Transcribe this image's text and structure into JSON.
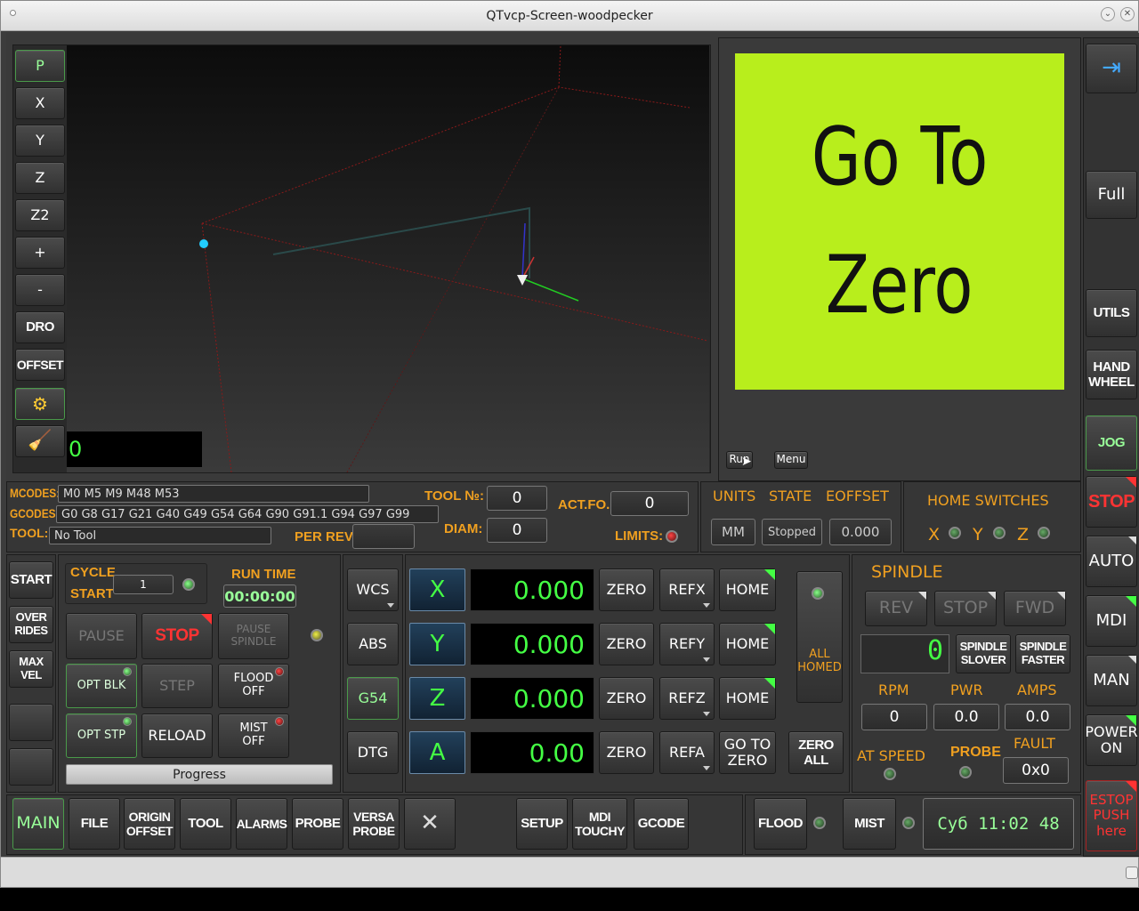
{
  "window": {
    "title": "QTvcp-Screen-woodpecker"
  },
  "left_toolbar": [
    "P",
    "X",
    "Y",
    "Z",
    "Z2",
    "+",
    "-",
    "DRO",
    "OFFSET"
  ],
  "gcode_counter": "0",
  "splash": {
    "line1": "Go To",
    "line2": "Zero",
    "run_label": "Run",
    "menu_label": "Menu"
  },
  "right_column": {
    "full": "Full",
    "utils": "UTILS",
    "hand": "HAND",
    "wheel": "WHEEL",
    "jog": "JOG",
    "stop": "STOP",
    "auto": "AUTO",
    "mdi": "MDI",
    "man": "MAN",
    "power1": "POWER",
    "power2": "ON",
    "estop1": "ESTOP",
    "estop2": "PUSH",
    "estop3": "here"
  },
  "status": {
    "mcodes_label": "MCODES:",
    "mcodes": "M0 M5 M9 M48 M53",
    "gcodes_label": "GCODES:",
    "gcodes": "G0 G8 G17 G21 G40 G49 G54 G64 G90 G91.1 G94 G97 G99",
    "tool_label": "TOOL:",
    "tool": "No Tool",
    "toolno_label": "TOOL №:",
    "toolno": "0",
    "diam_label": "DIAM:",
    "diam": "0",
    "actfo_label": "ACT.FO.",
    "actfo": "0",
    "perrev_label": "PER REV:",
    "perrev": "",
    "limits_label": "LIMITS:",
    "units_label": "UNITS",
    "state_label": "STATE",
    "eoffset_label": "EOFFSET",
    "units": "MM",
    "state": "Stopped",
    "eoffset": "0.000",
    "home_switches_label": "HOME SWITCHES",
    "hx": "X",
    "hy": "Y",
    "hz": "Z"
  },
  "program": {
    "start": "START",
    "over": "OVER",
    "rides": "RIDES",
    "max": "MAX",
    "vel": "VEL",
    "cycle": "CYCLE",
    "cstart": "START",
    "cycle_value": "1",
    "run_time_label": "RUN TIME",
    "run_time": "00:00:00",
    "pause": "PAUSE",
    "stop": "STOP",
    "pause_spindle1": "PAUSE",
    "pause_spindle2": "SPINDLE",
    "opt_blk": "OPT BLK",
    "step": "STEP",
    "flood1": "FLOOD",
    "flood2": "OFF",
    "opt_stp": "OPT STP",
    "reload": "RELOAD",
    "mist1": "MIST",
    "mist2": "OFF",
    "progress": "Progress"
  },
  "dro": {
    "wcs": "WCS",
    "abs": "ABS",
    "g54": "G54",
    "dtg": "DTG",
    "axes": [
      {
        "name": "X",
        "value": "0.000",
        "zero": "ZERO",
        "ref": "REFX",
        "home": "HOME"
      },
      {
        "name": "Y",
        "value": "0.000",
        "zero": "ZERO",
        "ref": "REFY",
        "home": "HOME"
      },
      {
        "name": "Z",
        "value": "0.000",
        "zero": "ZERO",
        "ref": "REFZ",
        "home": "HOME"
      },
      {
        "name": "A",
        "value": "0.00",
        "zero": "ZERO",
        "ref": "REFA",
        "home1": "GO TO",
        "home2": "ZERO"
      }
    ],
    "all1": "ALL",
    "all2": "HOMED",
    "zero_all1": "ZERO",
    "zero_all2": "ALL"
  },
  "spindle": {
    "title": "SPINDLE",
    "rev": "REV",
    "stop": "STOP",
    "fwd": "FWD",
    "speed": "0",
    "slower1": "SPINDLE",
    "slower2": "SLOVER",
    "faster1": "SPINDLE",
    "faster2": "FASTER",
    "rpm_label": "RPM",
    "pwr_label": "PWR",
    "amps_label": "AMPS",
    "rpm": "0",
    "pwr": "0.0",
    "amps": "0.0",
    "at_speed": "AT SPEED",
    "probe": "PROBE",
    "fault_label": "FAULT",
    "fault": "0x0"
  },
  "tabs": {
    "main": "MAIN",
    "file": "FILE",
    "origin1": "ORIGIN",
    "origin2": "OFFSET",
    "tool": "TOOL",
    "alarms": "ALARMS",
    "probe": "PROBE",
    "versa1": "VERSA",
    "versa2": "PROBE",
    "setup": "SETUP",
    "mdi1": "MDI",
    "mdi2": "TOUCHY",
    "gcode": "GCODE",
    "flood": "FLOOD",
    "mist": "MIST",
    "clock": "Суб 11:02 48"
  }
}
